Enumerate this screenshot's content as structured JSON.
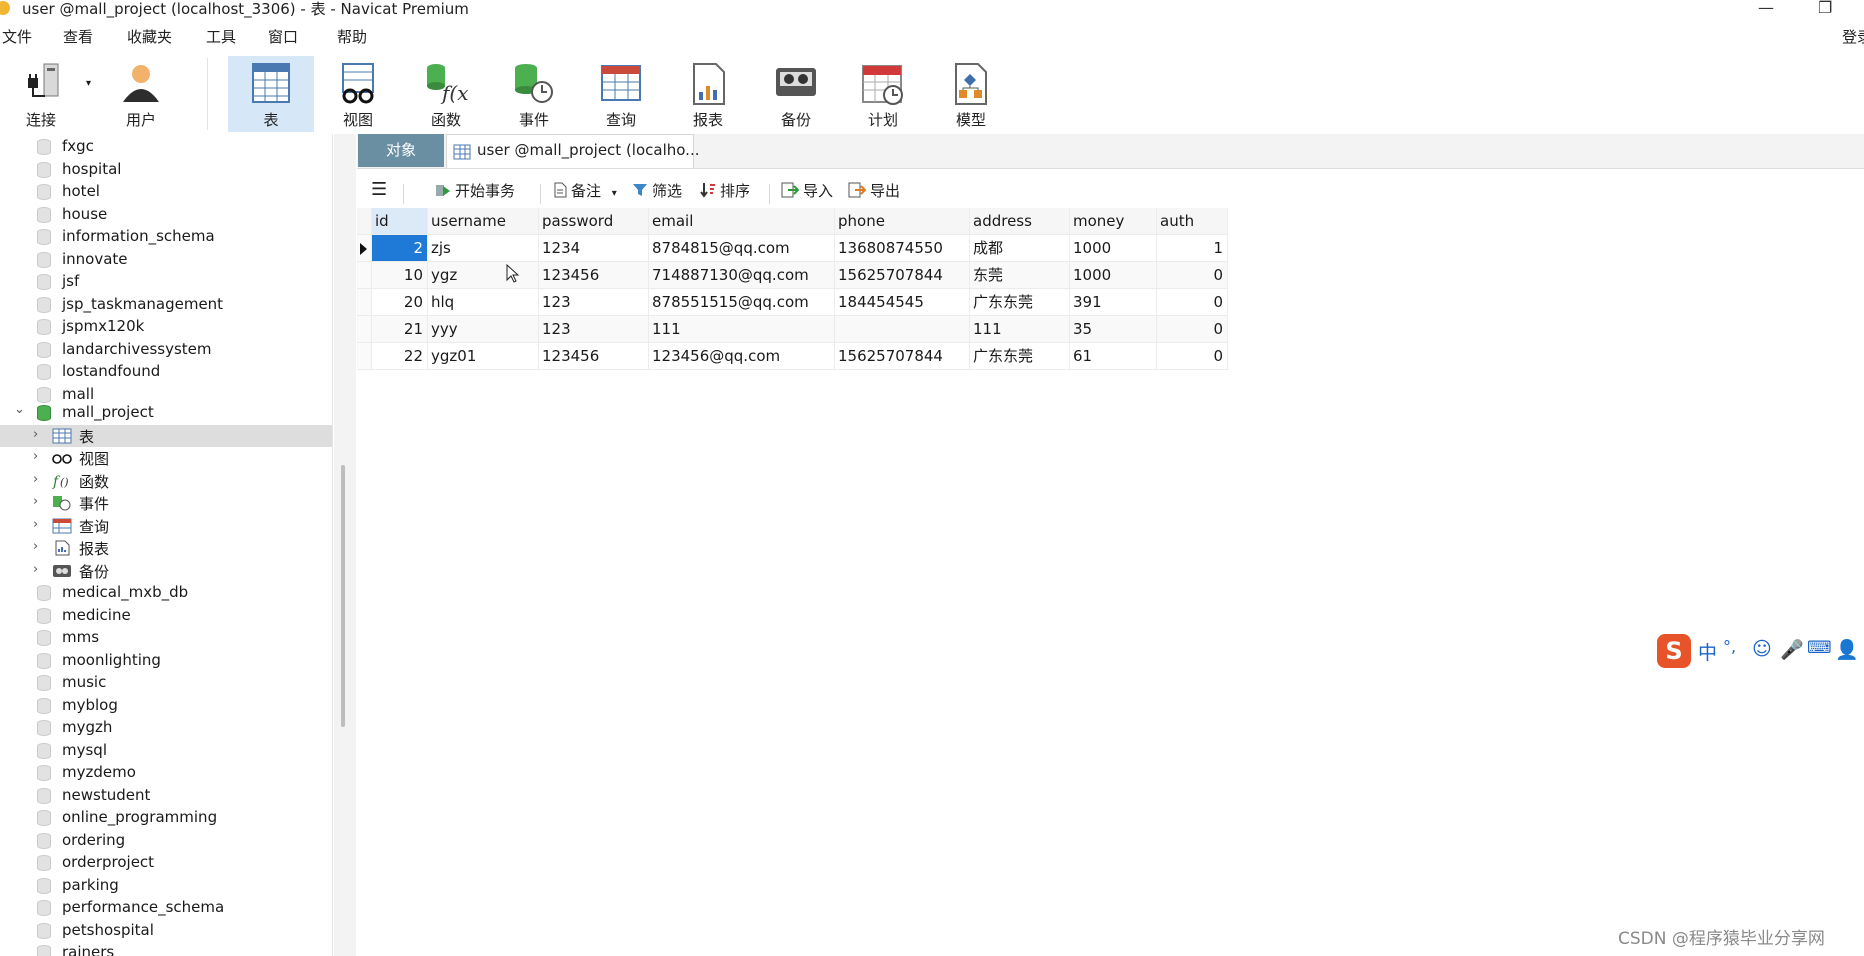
{
  "window": {
    "title": "user @mall_project (localhost_3306) - 表 - Navicat Premium"
  },
  "menu": [
    "文件",
    "查看",
    "收藏夹",
    "工具",
    "窗口",
    "帮助"
  ],
  "menu_right": "登录",
  "toolbar": {
    "connect": "连接",
    "user": "用户",
    "table": "表",
    "view": "视图",
    "function": "函数",
    "event": "事件",
    "query": "查询",
    "report": "报表",
    "backup": "备份",
    "schedule": "计划",
    "model": "模型"
  },
  "tree": {
    "databases_before": [
      "fxgc",
      "hospital",
      "hotel",
      "house",
      "information_schema",
      "innovate",
      "jsf",
      "jsp_taskmanagement",
      "jspmx120k",
      "landarchivessystem",
      "lostandfound",
      "mall"
    ],
    "open_db": "mall_project",
    "open_db_children": [
      "表",
      "视图",
      "函数",
      "事件",
      "查询",
      "报表",
      "备份"
    ],
    "databases_after": [
      "medical_mxb_db",
      "medicine",
      "mms",
      "moonlighting",
      "music",
      "myblog",
      "mygzh",
      "mysql",
      "myzdemo",
      "newstudent",
      "online_programming",
      "ordering",
      "orderproject",
      "parking",
      "performance_schema",
      "petshospital",
      "rainers"
    ]
  },
  "tabs": {
    "objects": "对象",
    "user": "user @mall_project (localho..."
  },
  "subtoolbar": {
    "begin_transaction": "开始事务",
    "note": "备注",
    "filter": "筛选",
    "sort": "排序",
    "import": "导入",
    "export": "导出"
  },
  "table": {
    "columns": [
      "id",
      "username",
      "password",
      "email",
      "phone",
      "address",
      "money",
      "auth"
    ],
    "rows": [
      [
        "2",
        "zjs",
        "1234",
        "8784815@qq.com",
        "13680874550",
        "成都",
        "1000",
        "1"
      ],
      [
        "10",
        "ygz",
        "123456",
        "714887130@qq.com",
        "15625707844",
        "东莞",
        "1000",
        "0"
      ],
      [
        "20",
        "hlq",
        "123",
        "878551515@qq.com",
        "184454545",
        "广东东莞",
        "391",
        "0"
      ],
      [
        "21",
        "yyy",
        "123",
        "111",
        "",
        "111",
        "35",
        "0"
      ],
      [
        "22",
        "ygz01",
        "123456",
        "123456@qq.com",
        "15625707844",
        "广东东莞",
        "61",
        "0"
      ]
    ]
  },
  "ime": {
    "lang": "中",
    "punct": "°,"
  },
  "watermark": "CSDN @程序猿毕业分享网"
}
